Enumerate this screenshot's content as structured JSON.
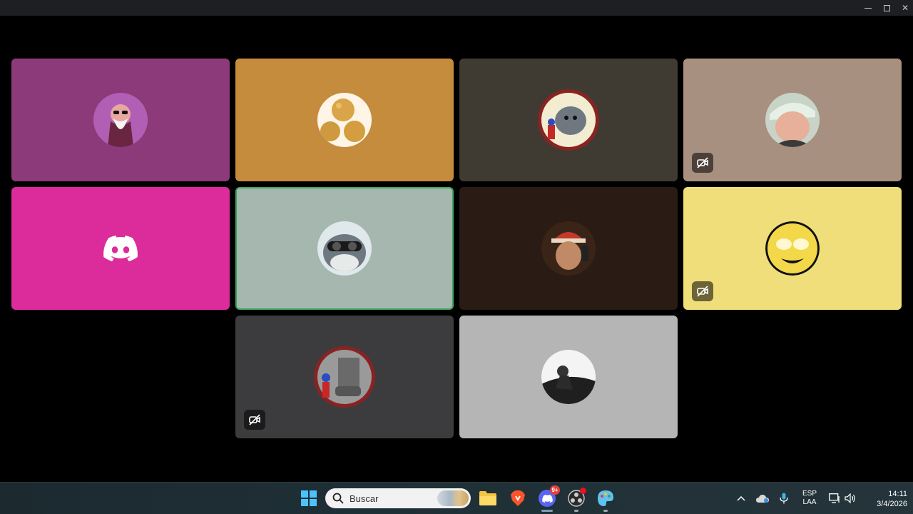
{
  "window": {
    "controls": [
      "minimize",
      "maximize",
      "close"
    ]
  },
  "tiles": [
    {
      "id": 1,
      "bg": "#8d3a7a",
      "avatar": "old-master-sunglasses",
      "video_off": false,
      "speaking": false
    },
    {
      "id": 2,
      "bg": "#c58c3e",
      "avatar": "cheese-bread-balls",
      "video_off": false,
      "speaking": false
    },
    {
      "id": 3,
      "bg": "#3f3b33",
      "avatar": "grey-elephant-with-toy",
      "video_off": false,
      "speaking": false
    },
    {
      "id": 4,
      "bg": "#a89080",
      "avatar": "person-with-cap",
      "video_off": true,
      "speaking": false
    },
    {
      "id": 5,
      "bg": "#dc2b9a",
      "avatar": "discord-logo",
      "video_off": false,
      "speaking": false
    },
    {
      "id": 6,
      "bg": "#a6b7b0",
      "avatar": "shark-with-goggles",
      "video_off": false,
      "speaking": true
    },
    {
      "id": 7,
      "bg": "#2a1b14",
      "avatar": "person-with-beanie",
      "video_off": false,
      "speaking": false
    },
    {
      "id": 8,
      "bg": "#f0de7a",
      "avatar": "yellow-smiley-sunglasses",
      "video_off": true,
      "speaking": false
    },
    {
      "id": 9,
      "bg": "#3c3c3f",
      "avatar": "car-with-toy-figure",
      "video_off": true,
      "speaking": false
    },
    {
      "id": 10,
      "bg": "#b5b5b5",
      "avatar": "monochrome-person-photo",
      "video_off": false,
      "speaking": false
    }
  ],
  "taskbar": {
    "search_placeholder": "Buscar",
    "apps": [
      "start-icon",
      "file-explorer-icon",
      "brave-icon",
      "discord-icon",
      "obs-icon",
      "paint-icon"
    ],
    "discord_badge": "9+",
    "language": "ESP",
    "layout": "LAA",
    "time": "14:11",
    "date": "3/4/2026"
  },
  "colors": {
    "speaking_border": "#3ba55c",
    "taskbar_bg": "#1f2f36"
  }
}
